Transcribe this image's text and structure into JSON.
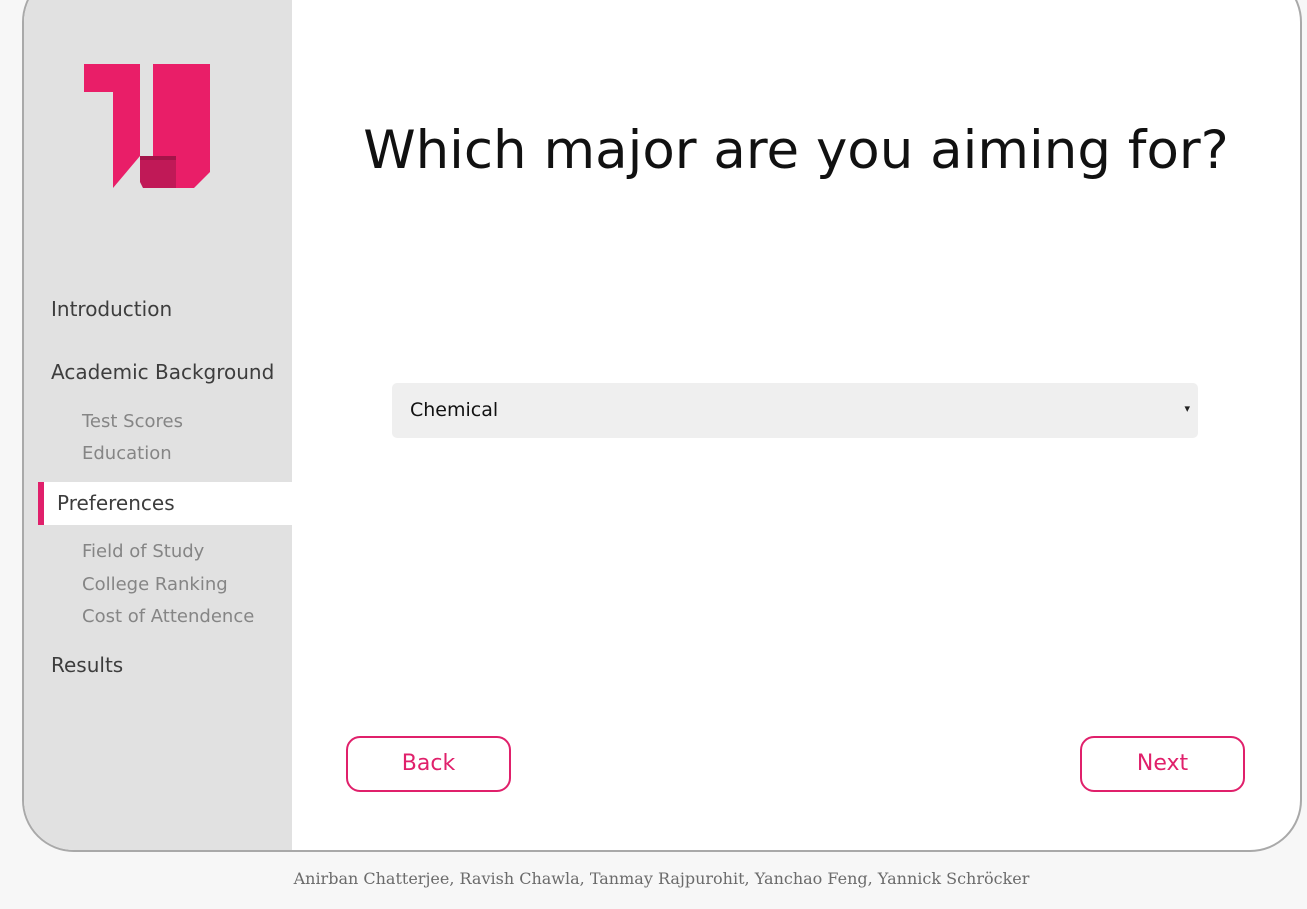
{
  "nav": {
    "introduction": "Introduction",
    "academic_background": "Academic Background",
    "test_scores": "Test Scores",
    "education": "Education",
    "preferences": "Preferences",
    "field_of_study": "Field of Study",
    "college_ranking": "College Ranking",
    "cost_of_attendence": "Cost of Attendence",
    "results": "Results"
  },
  "main": {
    "question": "Which major are you aiming for?",
    "major_select": {
      "selected": "Chemical",
      "caret": "▾"
    },
    "back_label": "Back",
    "next_label": "Next"
  },
  "footer": {
    "authors": "Anirban Chatterjee, Ravish Chawla, Tanmay Rajpurohit, Yanchao Feng, Yannick Schröcker"
  },
  "colors": {
    "accent": "#e0206b",
    "sidebar_bg": "#e1e1e1",
    "select_bg": "#efefef"
  },
  "icons": {
    "logo": "u-logo-icon"
  }
}
